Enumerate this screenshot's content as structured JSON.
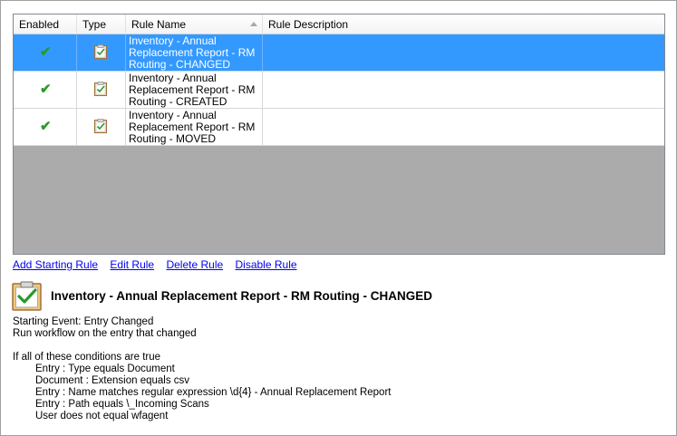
{
  "table": {
    "headers": {
      "enabled": "Enabled",
      "type": "Type",
      "rule_name": "Rule Name",
      "rule_description": "Rule Description"
    },
    "rows": [
      {
        "enabled": true,
        "type_icon": "clipboard-check-icon",
        "name": "Inventory - Annual\nReplacement Report - RM\nRouting - CHANGED",
        "description": "",
        "selected": true
      },
      {
        "enabled": true,
        "type_icon": "clipboard-check-icon",
        "name": "Inventory - Annual\nReplacement Report - RM\nRouting - CREATED",
        "description": "",
        "selected": false
      },
      {
        "enabled": true,
        "type_icon": "clipboard-check-icon",
        "name": "Inventory - Annual\nReplacement Report - RM\nRouting - MOVED",
        "description": "",
        "selected": false
      }
    ]
  },
  "actions": {
    "add": "Add Starting Rule",
    "edit": "Edit Rule",
    "delete": "Delete Rule",
    "disable": "Disable Rule"
  },
  "detail": {
    "title": "Inventory - Annual Replacement Report - RM Routing - CHANGED",
    "starting_event": "Starting Event: Entry Changed",
    "run_on": "Run workflow on the entry that changed",
    "conditions_header": "If all of these conditions are true",
    "conditions": [
      "Entry : Type equals Document",
      "Document : Extension equals csv",
      "Entry : Name matches regular expression \\d{4} - Annual Replacement Report",
      "Entry : Path equals \\_Incoming Scans",
      "User does not equal wfagent"
    ]
  },
  "colors": {
    "selection": "#3399ff",
    "check": "#2a9a2a",
    "empty_area": "#ababab",
    "link": "#0000ee"
  }
}
